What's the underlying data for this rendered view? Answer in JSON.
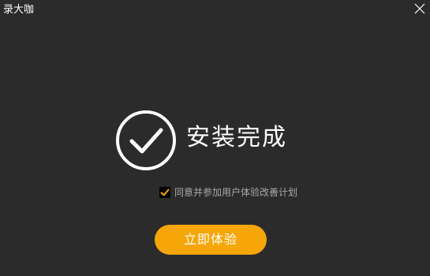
{
  "window": {
    "title": "录大咖",
    "close_icon": "close-icon"
  },
  "main": {
    "status_icon": "check-circle-icon",
    "headline": "安装完成",
    "consent": {
      "checked": true,
      "label": "同意并参加用户体验改善计划",
      "check_color": "#f6a609"
    },
    "primary_button": {
      "label": "立即体验",
      "color": "#f6a609"
    }
  },
  "colors": {
    "background": "#2b2b2c",
    "accent": "#f6a609",
    "muted_text": "#a9a9a9"
  }
}
